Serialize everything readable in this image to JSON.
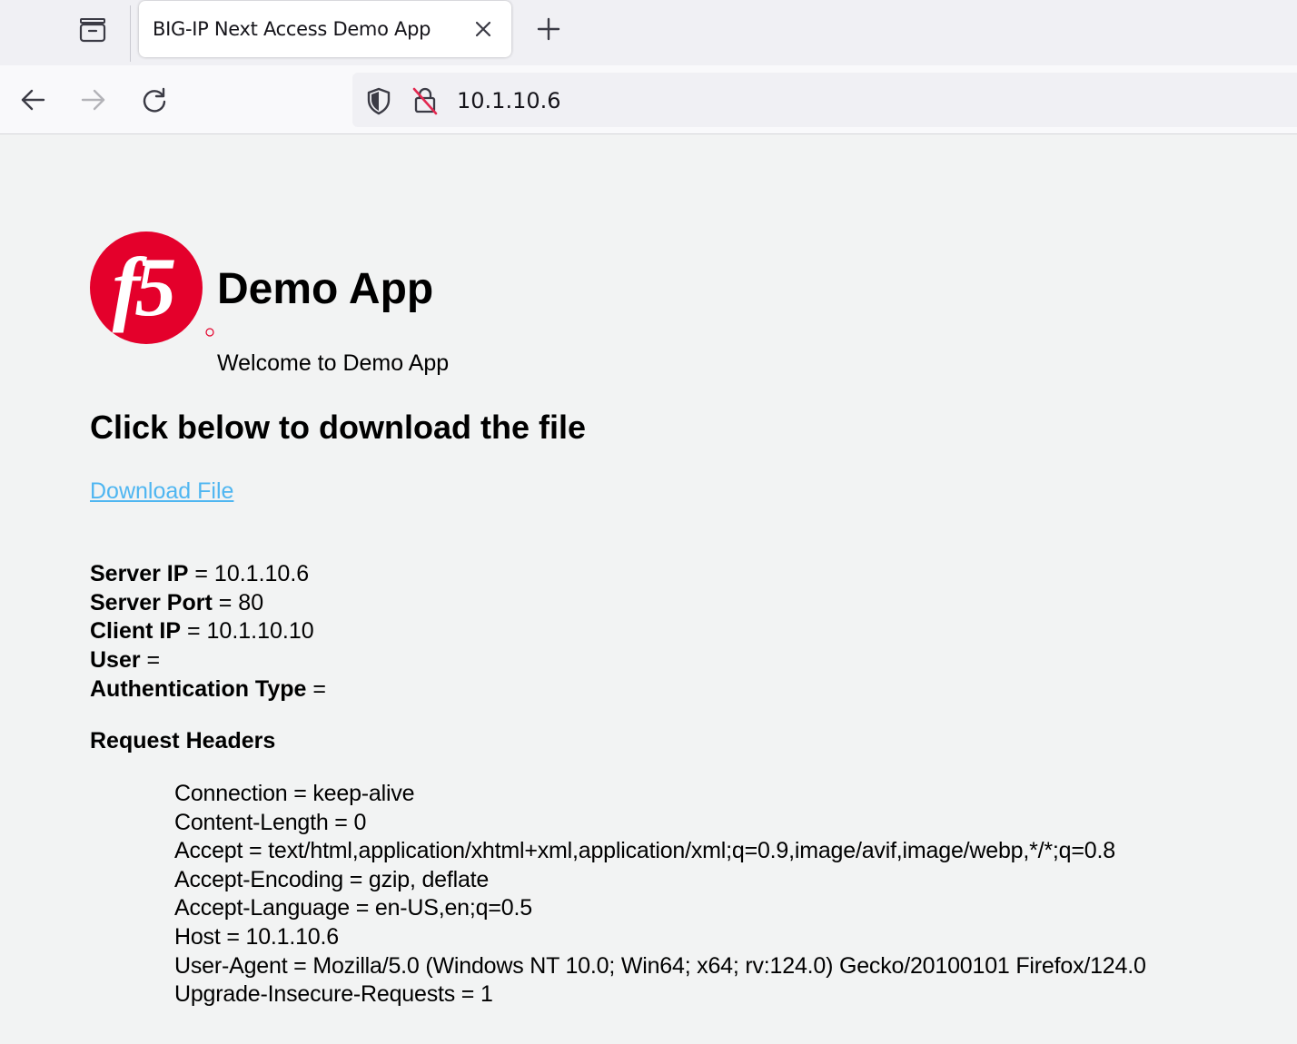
{
  "browser": {
    "tab": {
      "title": "BIG-IP Next Access Demo App"
    },
    "url": "10.1.10.6",
    "icons": {
      "tab_list": "tab-list-icon",
      "close": "close-icon",
      "new_tab": "plus-icon",
      "back": "back-arrow-icon",
      "forward": "forward-arrow-icon",
      "reload": "reload-icon",
      "tracking_protection": "shield-icon",
      "insecure": "insecure-lock-icon"
    }
  },
  "page": {
    "logo": {
      "text": "f5",
      "color": "#e4002b"
    },
    "title": "Demo App",
    "welcome": "Welcome to Demo App",
    "download_heading": "Click below to download the file",
    "download_link": "Download File",
    "link_color": "#4fb6f1",
    "info": [
      {
        "label": "Server IP",
        "sep": " = ",
        "value": "10.1.10.6"
      },
      {
        "label": "Server Port",
        "sep": " = ",
        "value": "80"
      },
      {
        "label": "Client IP",
        "sep": " = ",
        "value": "10.1.10.10"
      },
      {
        "label": "User",
        "sep": " = ",
        "value": ""
      },
      {
        "label": "Authentication Type",
        "sep": " = ",
        "value": ""
      }
    ],
    "request_headers_title": "Request Headers",
    "request_headers": [
      "Connection = keep-alive",
      "Content-Length = 0",
      "Accept = text/html,application/xhtml+xml,application/xml;q=0.9,image/avif,image/webp,*/*;q=0.8",
      "Accept-Encoding = gzip, deflate",
      "Accept-Language = en-US,en;q=0.5",
      "Host = 10.1.10.6",
      "User-Agent = Mozilla/5.0 (Windows NT 10.0; Win64; x64; rv:124.0) Gecko/20100101 Firefox/124.0",
      "Upgrade-Insecure-Requests = 1"
    ]
  }
}
